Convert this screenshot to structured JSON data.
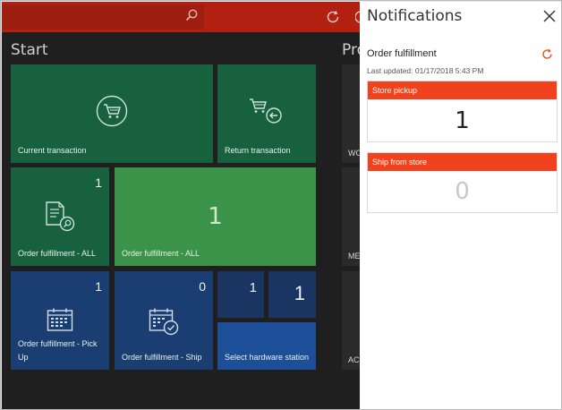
{
  "app": {
    "start_title": "Start",
    "pro_title": "Pro",
    "tiles": {
      "current_transaction": {
        "label": "Current transaction",
        "icon": "cart-icon"
      },
      "return_transaction": {
        "label": "Return transaction",
        "icon": "cart-return-icon"
      },
      "order_fulfillment_all": {
        "label": "Order fulfillment - ALL",
        "count": "1",
        "icon": "document-search-icon"
      },
      "order_fulfillment_all_big": {
        "label": "Order fulfillment - ALL",
        "count": "1"
      },
      "order_fulfillment_pickup": {
        "label": "Order fulfillment - Pick Up",
        "count": "1",
        "icon": "calendar-icon"
      },
      "order_fulfillment_ship": {
        "label": "Order fulfillment - Ship",
        "count": "0",
        "icon": "calendar-check-icon"
      },
      "small_tile_1": {
        "count": "1"
      },
      "small_tile_2": {
        "count": "1"
      },
      "select_hardware_station": {
        "label": "Select hardware station"
      }
    },
    "side_labels": [
      "WO",
      "ME",
      "AC"
    ]
  },
  "notifications": {
    "title": "Notifications",
    "section_title": "Order fulfillment",
    "last_updated": "Last updated: 01/17/2018 5:43 PM",
    "cards": [
      {
        "label": "Store pickup",
        "value": "1"
      },
      {
        "label": "Ship from store",
        "value": "0"
      }
    ]
  },
  "colors": {
    "topbar": "#b12011",
    "tile_green": "#17613e",
    "tile_green_light": "#3a9348",
    "tile_blue": "#1b3e72",
    "card_header": "#f0421d"
  }
}
